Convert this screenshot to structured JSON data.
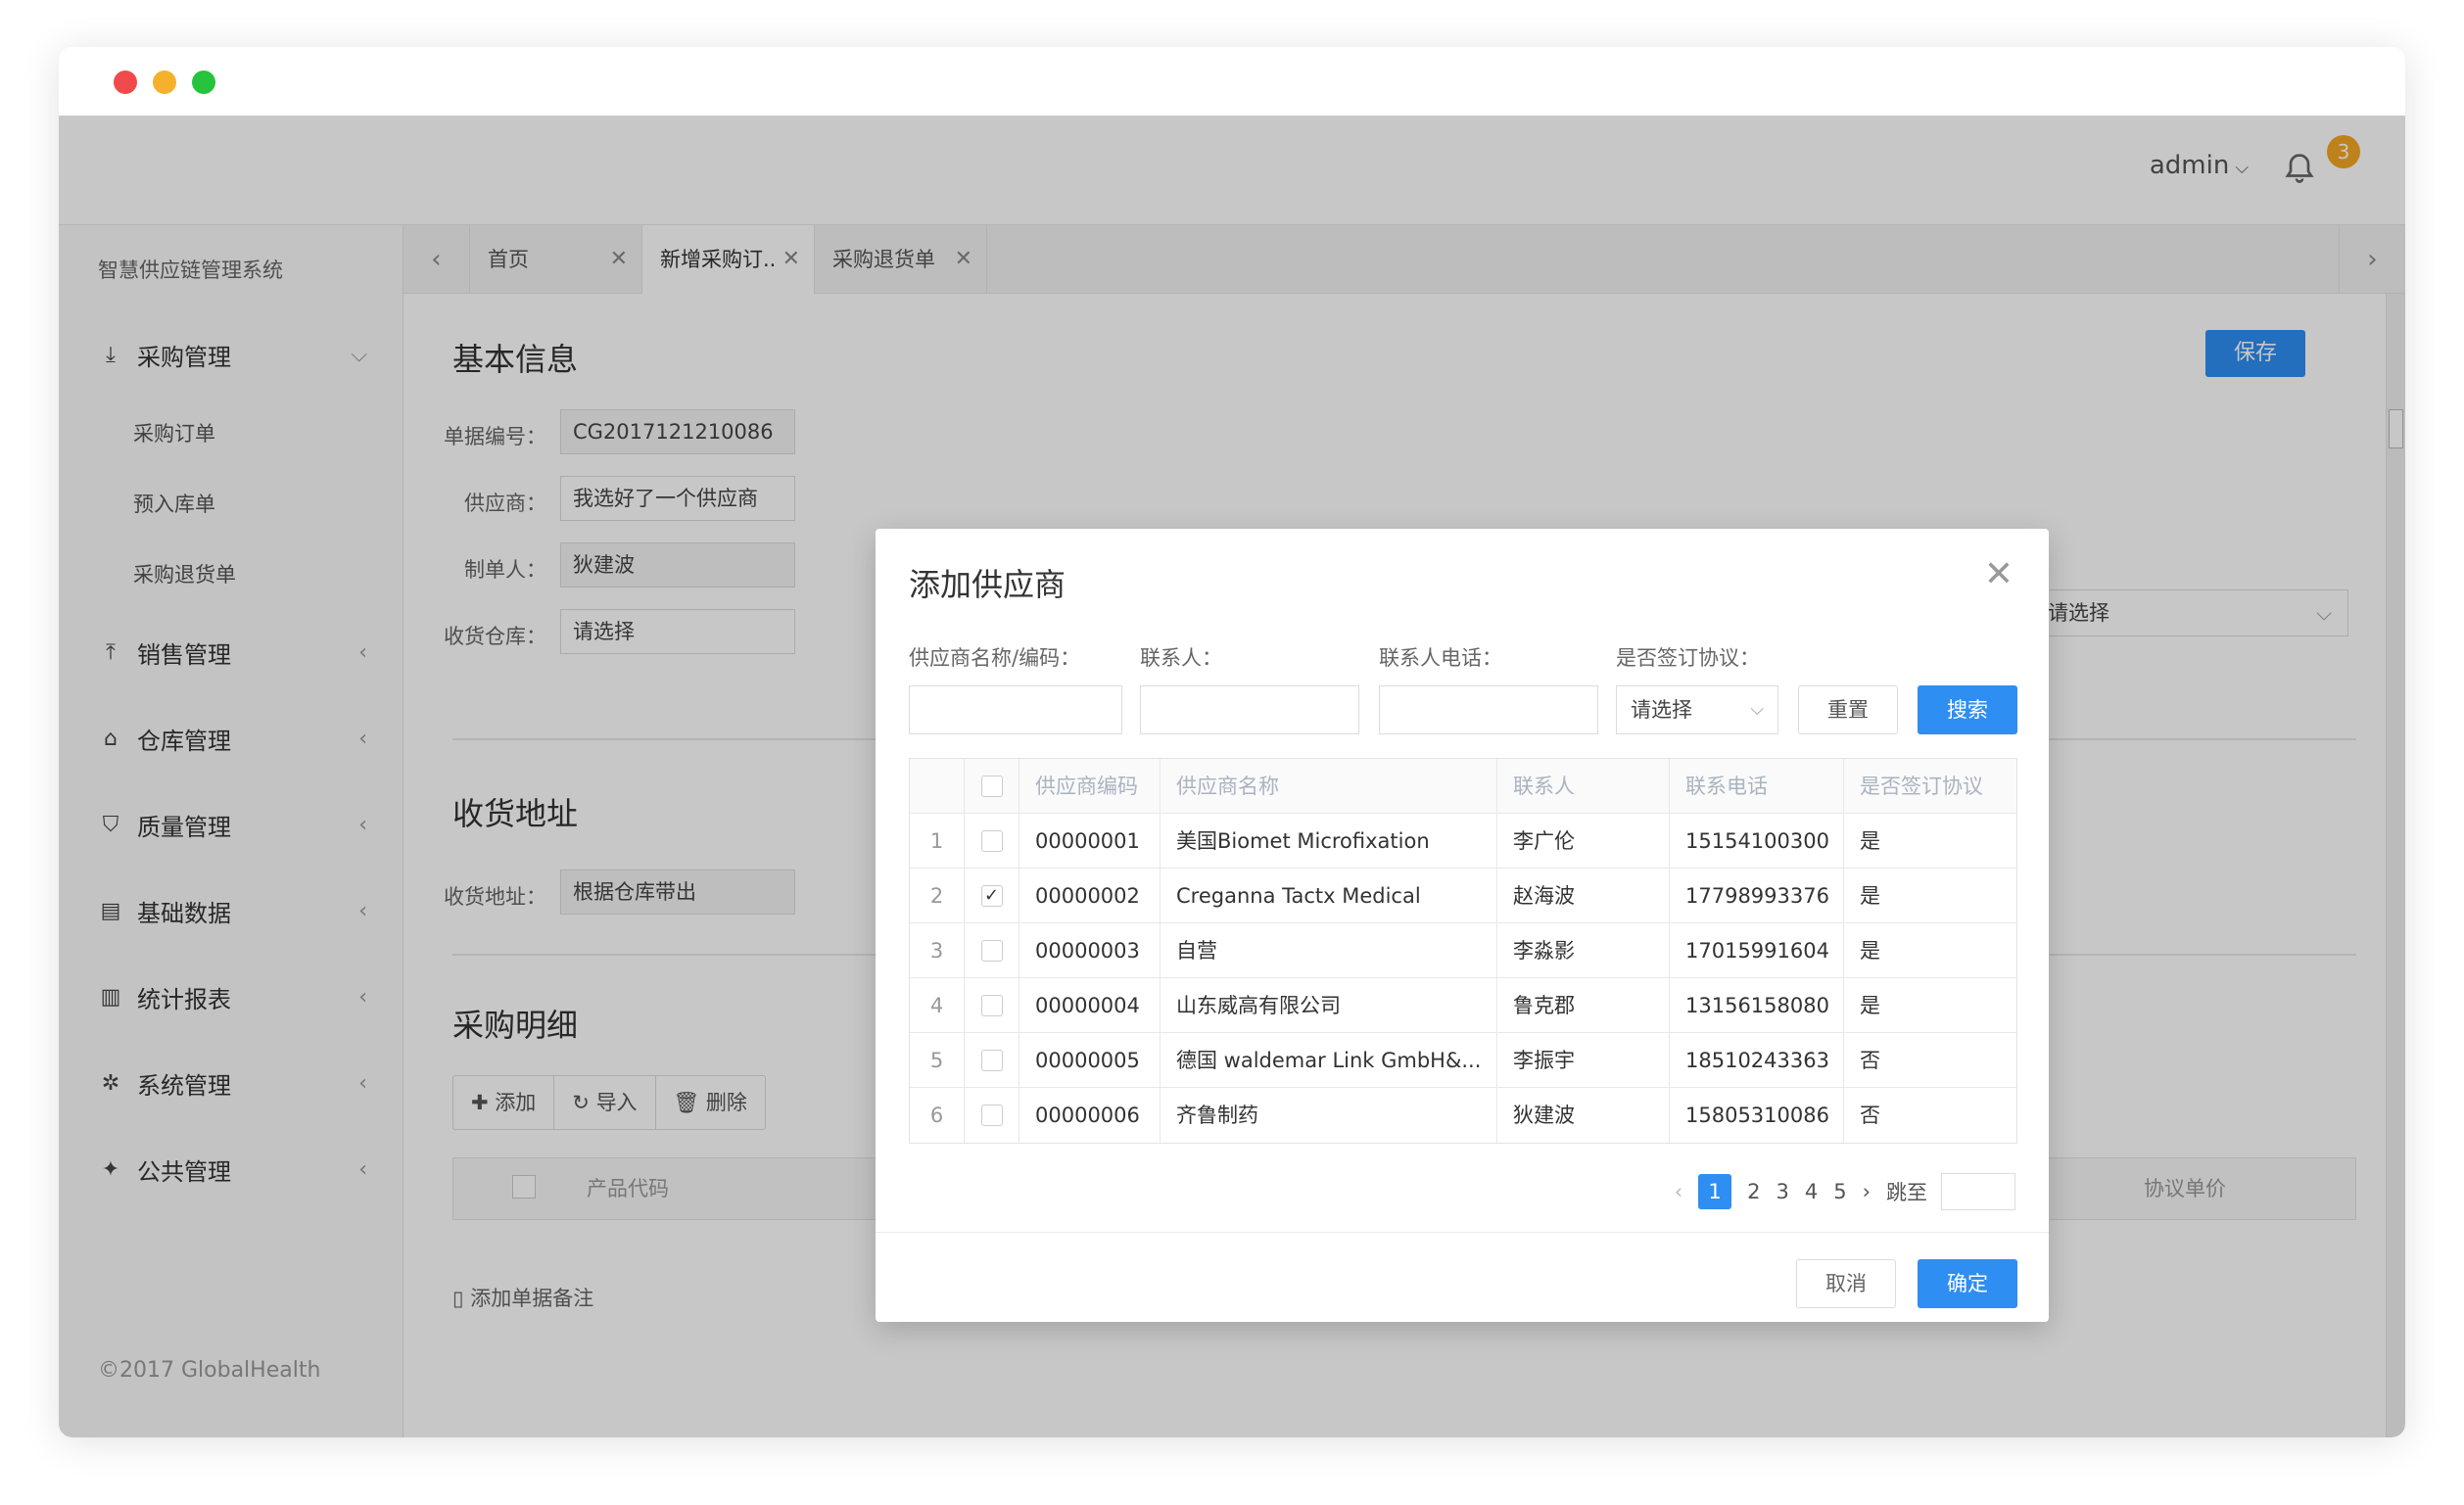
{
  "header": {
    "user": "admin",
    "notification_count": "3"
  },
  "sidebar": {
    "brand": "智慧供应链管理系统",
    "menu": [
      {
        "label": "采购管理",
        "icon": "download-icon",
        "expanded": true,
        "children": [
          "采购订单",
          "预入库单",
          "采购退货单"
        ]
      },
      {
        "label": "销售管理",
        "icon": "upload-icon"
      },
      {
        "label": "仓库管理",
        "icon": "home-icon"
      },
      {
        "label": "质量管理",
        "icon": "shield-icon"
      },
      {
        "label": "基础数据",
        "icon": "database-icon"
      },
      {
        "label": "统计报表",
        "icon": "bar-chart-icon"
      },
      {
        "label": "系统管理",
        "icon": "gear-icon"
      },
      {
        "label": "公共管理",
        "icon": "pin-icon"
      }
    ],
    "copyright": "©2017 GlobalHealth"
  },
  "tabs": [
    "首页",
    "新增采购订..",
    "采购退货单"
  ],
  "form": {
    "section_basic": "基本信息",
    "save_label": "保存",
    "doc_no_label": "单据编号：",
    "doc_no_value": "CG2017121210086",
    "supplier_label": "供应商：",
    "supplier_value": "我选好了一个供应商",
    "maker_label": "制单人：",
    "maker_value": "狄建波",
    "warehouse_label": "收货仓库：",
    "warehouse_value": "请选择",
    "right_select_value": "请选择",
    "section_address": "收货地址",
    "address_label": "收货地址：",
    "address_value": "根据仓库带出",
    "section_detail": "采购明细",
    "btn_add": "添加",
    "btn_import": "导入",
    "btn_delete": "删除",
    "col_product_code": "产品代码",
    "col_agreement_price": "协议单价",
    "add_note": "添加单据备注"
  },
  "modal": {
    "title": "添加供应商",
    "filter_name_label": "供应商名称/编码：",
    "filter_contact_label": "联系人：",
    "filter_phone_label": "联系人电话：",
    "filter_agreement_label": "是否签订协议：",
    "filter_agreement_value": "请选择",
    "btn_reset": "重置",
    "btn_search": "搜索",
    "columns": [
      "供应商编码",
      "供应商名称",
      "联系人",
      "联系电话",
      "是否签订协议"
    ],
    "rows": [
      {
        "idx": "1",
        "checked": false,
        "code": "00000001",
        "name": "美国Biomet Microfixation",
        "contact": "李广伦",
        "phone": "15154100300",
        "agreement": "是"
      },
      {
        "idx": "2",
        "checked": true,
        "code": "00000002",
        "name": "Creganna Tactx Medical",
        "contact": "赵海波",
        "phone": "17798993376",
        "agreement": "是"
      },
      {
        "idx": "3",
        "checked": false,
        "code": "00000003",
        "name": "自营",
        "contact": "李淼影",
        "phone": "17015991604",
        "agreement": "是"
      },
      {
        "idx": "4",
        "checked": false,
        "code": "00000004",
        "name": "山东威高有限公司",
        "contact": "鲁克郡",
        "phone": "13156158080",
        "agreement": "是"
      },
      {
        "idx": "5",
        "checked": false,
        "code": "00000005",
        "name": "德国 waldemar Link GmbH&...",
        "contact": "李振宇",
        "phone": "18510243363",
        "agreement": "否"
      },
      {
        "idx": "6",
        "checked": false,
        "code": "00000006",
        "name": "齐鲁制药",
        "contact": "狄建波",
        "phone": "15805310086",
        "agreement": "否"
      }
    ],
    "pager": {
      "prev": "‹",
      "pages": [
        "1",
        "2",
        "3",
        "4",
        "5"
      ],
      "current": "1",
      "next": "›",
      "jump_label": "跳至"
    },
    "btn_cancel": "取消",
    "btn_ok": "确定"
  }
}
